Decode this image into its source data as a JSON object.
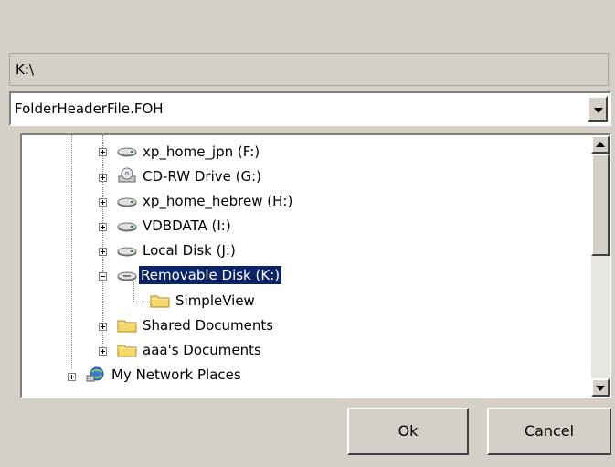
{
  "path": {
    "text": "K:\\"
  },
  "file_combo": {
    "value": "FolderHeaderFile.FOH",
    "icon": "chevron-down-icon"
  },
  "tree": {
    "items": [
      {
        "label": "xp_home_jpn (F:)",
        "icon": "drive-icon",
        "expander": "+"
      },
      {
        "label": "CD-RW Drive (G:)",
        "icon": "cd-drive-icon",
        "expander": "+"
      },
      {
        "label": "xp_home_hebrew (H:)",
        "icon": "drive-icon",
        "expander": "+"
      },
      {
        "label": "VDBDATA (I:)",
        "icon": "drive-icon",
        "expander": "+"
      },
      {
        "label": "Local Disk (J:)",
        "icon": "drive-icon",
        "expander": "+"
      },
      {
        "label": "Removable Disk (K:)",
        "icon": "removable-drive-icon",
        "expander": "-",
        "selected": true
      },
      {
        "label": "SimpleView",
        "icon": "folder-icon"
      },
      {
        "label": "Shared Documents",
        "icon": "folder-icon",
        "expander": "+"
      },
      {
        "label": "aaa's Documents",
        "icon": "folder-icon",
        "expander": "+"
      },
      {
        "label": "My Network Places",
        "icon": "network-places-icon",
        "expander": "+"
      }
    ]
  },
  "buttons": {
    "ok": "Ok",
    "cancel": "Cancel"
  },
  "colors": {
    "dialog_bg": "#d4d0c8",
    "selection_bg": "#0a246a",
    "selection_fg": "#ffffff"
  }
}
